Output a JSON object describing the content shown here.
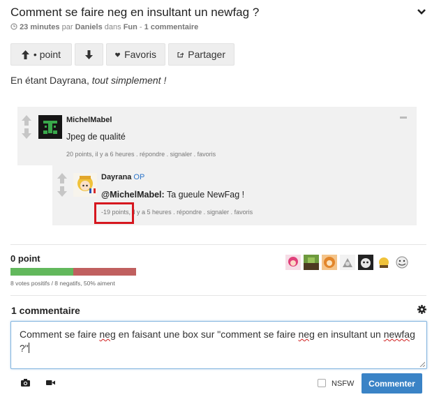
{
  "post": {
    "title": "Comment se faire neg en insultant un newfag ?",
    "time": "23 minutes",
    "by": "par",
    "author": "Daniels",
    "in": "dans",
    "category": "Fun",
    "sep": "-",
    "comment_count_label": "1 commentaire",
    "body_prefix": "En étant Dayrana,",
    "body_italic": "tout simplement !"
  },
  "actions": {
    "point_label": "• point",
    "fav_label": "Favoris",
    "share_label": "Partager"
  },
  "embedded": {
    "comment1": {
      "user": "MichelMabel",
      "text": "Jpeg de qualité",
      "meta": "20 points, il y a 6 heures . répondre . signaler . favoris"
    },
    "comment2": {
      "user": "Dayrana",
      "badge": "OP",
      "mention": "@MichelMabel:",
      "text": "Ta gueule NewFag !",
      "points": "-19 points",
      "meta": ", il y a 5 heures . répondre . signaler . favoris"
    }
  },
  "votes": {
    "score_label": "0 point",
    "positive": 8,
    "negative": 8,
    "summary": "8 votes positifs / 8 negatifs, 50% aiment",
    "colors": {
      "positive": "#62b85c",
      "negative": "#c0605f"
    },
    "voters": [
      "voter-1",
      "voter-2",
      "voter-3",
      "voter-4",
      "voter-5",
      "voter-6",
      "voter-7"
    ]
  },
  "comments": {
    "title": "1 commentaire",
    "draft_a": "Comment se faire ",
    "draft_neg1": "neg",
    "draft_b": " en faisant une box sur \"comment se faire ",
    "draft_neg2": "neg",
    "draft_c": " en insultant un ",
    "draft_newfag": "newfag",
    "draft_d": " ?\"",
    "nsfw_label": "NSFW",
    "submit_label": "Commenter"
  }
}
